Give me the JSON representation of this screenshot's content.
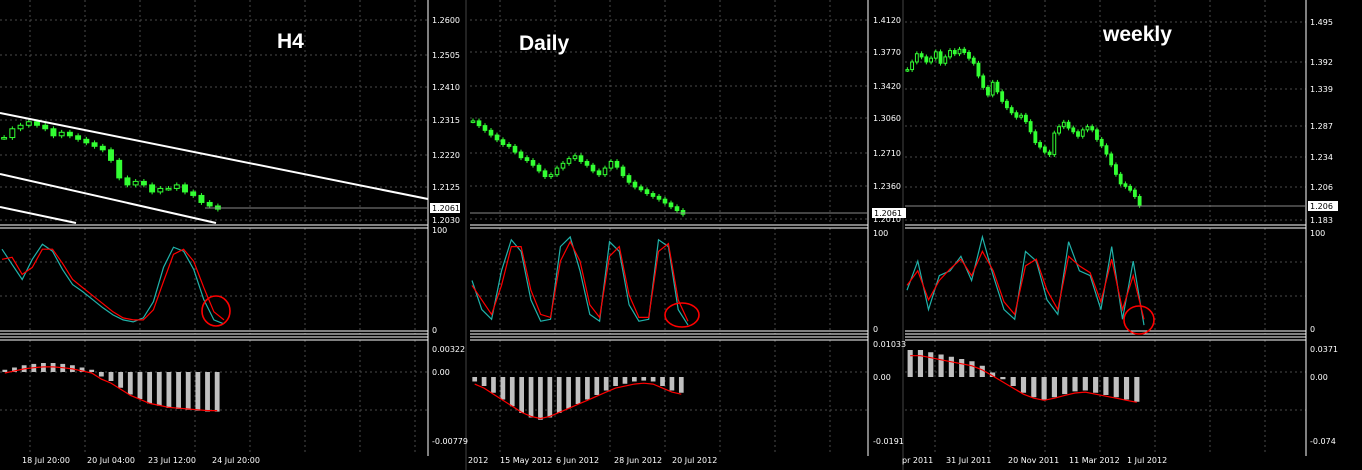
{
  "colors": {
    "background": "#000000",
    "grid": "#4a4a4a",
    "frame": "#ffffff",
    "candle": "#33ff33",
    "channel": "#ffffff",
    "stoch_main": "#20b2aa",
    "stoch_signal": "#ff0000",
    "macd_hist": "#c0c0c0",
    "macd_signal": "#ff0000",
    "circle": "#ff0000"
  },
  "panels": [
    {
      "id": "h4",
      "title": "H4",
      "price_ticks": [
        "1.2600",
        "1.2505",
        "1.2410",
        "1.2315",
        "1.2220",
        "1.2125",
        "1.2030"
      ],
      "current_price": "1.2061",
      "stoch_ticks": [
        "100",
        "0"
      ],
      "macd_ticks": [
        "0.00322",
        "0.00",
        "-0.00779"
      ],
      "dates": [
        "18 Jul 20:00",
        "20 Jul 04:00",
        "23 Jul 12:00",
        "24 Jul 20:00"
      ]
    },
    {
      "id": "daily",
      "title": "Daily",
      "price_ticks": [
        "1.4120",
        "1.3770",
        "1.3420",
        "1.3060",
        "1.2710",
        "1.2360",
        "1.2010"
      ],
      "current_price": "1.2061",
      "stoch_ticks": [
        "100",
        "0"
      ],
      "macd_ticks": [
        "0.01033",
        "0.00",
        "-0.0191"
      ],
      "dates": [
        "2012",
        "15 May 2012",
        "6 Jun 2012",
        "28 Jun 2012",
        "20 Jul 2012"
      ]
    },
    {
      "id": "weekly",
      "title": "weekly",
      "price_ticks": [
        "1.495",
        "1.392",
        "1.339",
        "1.287",
        "1.234",
        "1.206",
        "1.183"
      ],
      "current_price": "1.206",
      "stoch_ticks": [
        "100",
        "0"
      ],
      "macd_ticks": [
        "0.0371",
        "0.00",
        "-0.074"
      ],
      "dates": [
        "pr 2011",
        "31 Jul 2011",
        "20 Nov 2011",
        "11 Mar 2012",
        "1 Jul 2012"
      ]
    }
  ],
  "chart_data": [
    {
      "type": "candlestick",
      "title": "H4",
      "ylim": [
        1.203,
        1.26
      ],
      "close": [
        1.2265,
        1.229,
        1.23,
        1.231,
        1.23,
        1.229,
        1.227,
        1.228,
        1.227,
        1.226,
        1.225,
        1.224,
        1.223,
        1.22,
        1.215,
        1.213,
        1.214,
        1.213,
        1.211,
        1.212,
        1.212,
        1.213,
        1.211,
        1.21,
        1.208,
        1.207,
        1.2061
      ]
    },
    {
      "type": "candlestick",
      "title": "Daily",
      "ylim": [
        1.201,
        1.412
      ],
      "close": [
        1.305,
        1.3,
        1.295,
        1.29,
        1.285,
        1.28,
        1.278,
        1.272,
        1.266,
        1.263,
        1.258,
        1.252,
        1.246,
        1.248,
        1.255,
        1.26,
        1.265,
        1.268,
        1.262,
        1.258,
        1.252,
        1.248,
        1.255,
        1.262,
        1.256,
        1.247,
        1.24,
        1.235,
        1.232,
        1.228,
        1.225,
        1.222,
        1.218,
        1.214,
        1.21,
        1.2061
      ]
    },
    {
      "type": "candlestick",
      "title": "weekly",
      "ylim": [
        1.183,
        1.495
      ],
      "close": [
        1.42,
        1.432,
        1.445,
        1.44,
        1.432,
        1.438,
        1.448,
        1.43,
        1.44,
        1.45,
        1.445,
        1.452,
        1.447,
        1.438,
        1.43,
        1.41,
        1.392,
        1.38,
        1.4,
        1.385,
        1.37,
        1.36,
        1.352,
        1.345,
        1.348,
        1.338,
        1.322,
        1.305,
        1.298,
        1.29,
        1.286,
        1.32,
        1.33,
        1.337,
        1.328,
        1.322,
        1.315,
        1.325,
        1.33,
        1.325,
        1.31,
        1.3,
        1.287,
        1.27,
        1.255,
        1.24,
        1.236,
        1.23,
        1.22,
        1.206
      ]
    }
  ]
}
